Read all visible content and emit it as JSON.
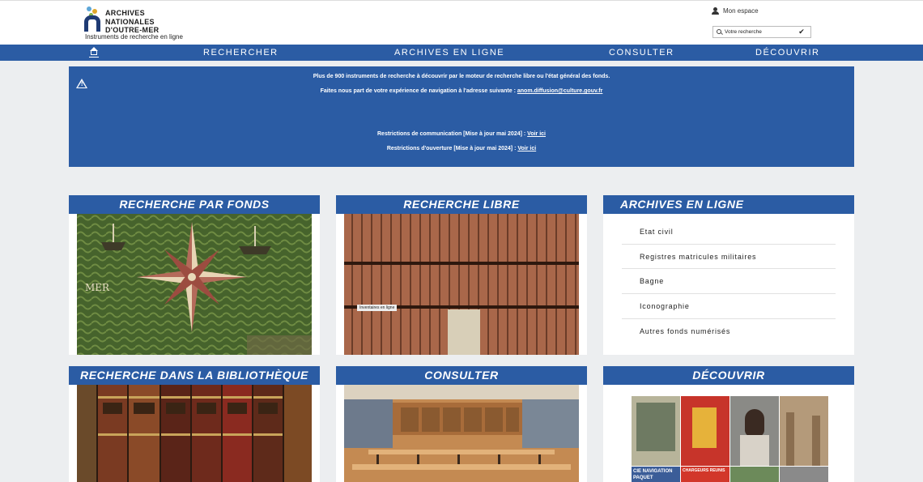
{
  "header": {
    "logo_lines": [
      "ARCHIVES",
      "NATIONALES",
      "D'OUTRE-MER"
    ],
    "subtitle": "Instruments de recherche en ligne",
    "account_label": "Mon espace",
    "search_placeholder": "Votre recherche"
  },
  "nav": {
    "items": [
      "RECHERCHER",
      "ARCHIVES EN LIGNE",
      "CONSULTER",
      "DÉCOUVRIR"
    ]
  },
  "alert": {
    "line1": "Plus de 900 instruments de recherche à découvrir par le moteur de recherche libre ou l'état général des fonds.",
    "line2_text": "Faites nous part de votre expérience de navigation à l'adresse suivante : ",
    "line2_link": "anom.diffusion@culture.gouv.fr",
    "line3_text": "Restrictions de communication [Mise à jour mai 2024] : ",
    "line3_link": "Voir ici",
    "line4_text": "Restrictions d'ouverture [Mise à jour mai 2024] : ",
    "line4_link": "Voir ici"
  },
  "cards": {
    "fonds": {
      "title": "Recherche par fonds"
    },
    "libre": {
      "title": "Recherche libre",
      "image_caption": "Inventaires en ligne"
    },
    "archives": {
      "title": "Archives en ligne",
      "links": [
        "Etat civil",
        "Registres matricules militaires",
        "Bagne",
        "Iconographie",
        "Autres fonds numérisés"
      ]
    },
    "bibliotheque": {
      "title": "Recherche dans la bibliothèque"
    },
    "consulter": {
      "title": "Consulter"
    },
    "decouvrir": {
      "title": "Découvrir",
      "poster_texts": [
        "CIE NAVIGATION PAQUET",
        "CHARGEURS REUNIS"
      ]
    }
  },
  "colors": {
    "brand_blue": "#2b5ca4",
    "background": "#eceef0"
  }
}
